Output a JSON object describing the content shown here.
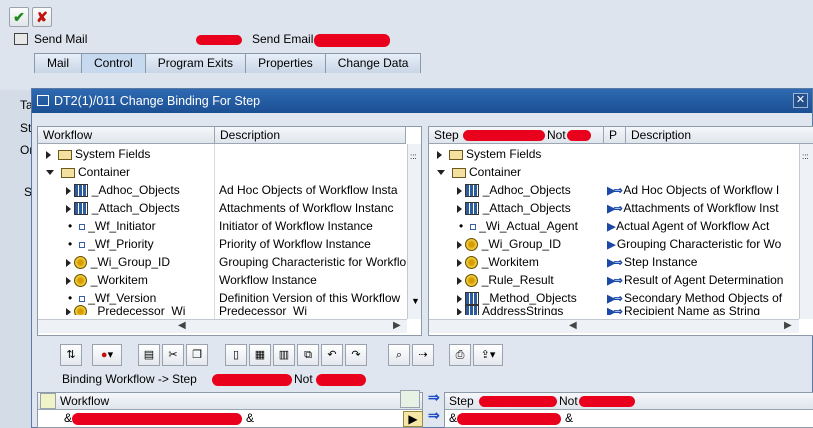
{
  "toolbar": {
    "confirm_label": "✔",
    "cancel_label": "✘"
  },
  "send_mail_label": "Send Mail",
  "send_email_label": "Send Email",
  "tabs": [
    {
      "label": "Mail"
    },
    {
      "label": "Control"
    },
    {
      "label": "Program Exits"
    },
    {
      "label": "Properties"
    },
    {
      "label": "Change Data"
    }
  ],
  "left_labels": [
    "Ta",
    "St",
    "Or",
    "S"
  ],
  "dialog": {
    "title": "DT2(1)/011 Change Binding For Step",
    "close_label": "✕"
  },
  "left_tree": {
    "col_workflow": "Workflow",
    "col_description": "Description",
    "rows": [
      {
        "name": "System Fields",
        "desc": ""
      },
      {
        "name": "Container",
        "desc": ""
      },
      {
        "name": "_Adhoc_Objects",
        "desc": "Ad Hoc Objects of Workflow Insta"
      },
      {
        "name": "_Attach_Objects",
        "desc": "Attachments of Workflow Instanc"
      },
      {
        "name": "_Wf_Initiator",
        "desc": "Initiator of Workflow Instance"
      },
      {
        "name": "_Wf_Priority",
        "desc": "Priority of Workflow Instance"
      },
      {
        "name": "_Wi_Group_ID",
        "desc": "Grouping Characteristic for Workflo"
      },
      {
        "name": "_Workitem",
        "desc": "Workflow Instance"
      },
      {
        "name": "_Wf_Version",
        "desc": "Definition Version of this Workflow"
      },
      {
        "name": "_Predecessor_Wi",
        "desc": "Predecessor_Wi"
      }
    ]
  },
  "right_tree": {
    "col_step": "Step",
    "col_step_suffix": "Not",
    "col_p": "P",
    "col_description": "Description",
    "rows": [
      {
        "name": "System Fields",
        "desc": ""
      },
      {
        "name": "Container",
        "desc": ""
      },
      {
        "name": "_Adhoc_Objects",
        "desc": "Ad Hoc Objects of Workflow I"
      },
      {
        "name": "_Attach_Objects",
        "desc": "Attachments of Workflow Inst"
      },
      {
        "name": "_Wi_Actual_Agent",
        "desc": "Actual Agent of Workflow Act"
      },
      {
        "name": "_Wi_Group_ID",
        "desc": "Grouping Characteristic for Wo"
      },
      {
        "name": "_Workitem",
        "desc": "Step Instance"
      },
      {
        "name": "_Rule_Result",
        "desc": "Result of Agent Determination"
      },
      {
        "name": "_Method_Objects",
        "desc": "Secondary Method Objects of"
      },
      {
        "name": "AddressStrings",
        "desc": "Recipient Name as String"
      }
    ]
  },
  "binding": {
    "title_prefix": "Binding Workflow  -> Step",
    "title_suffix": "Not",
    "col_workflow": "Workflow",
    "col_step": "Step",
    "col_step_suffix": "Not",
    "row_left": "&",
    "row_left_end": "&",
    "row_right": "&",
    "row_right_end": "&"
  },
  "scroll_grip": ":::",
  "colors": {
    "title_bar": "#1b4f93",
    "redaction": "#e8001c",
    "pane_border": "#8e9aa8"
  }
}
